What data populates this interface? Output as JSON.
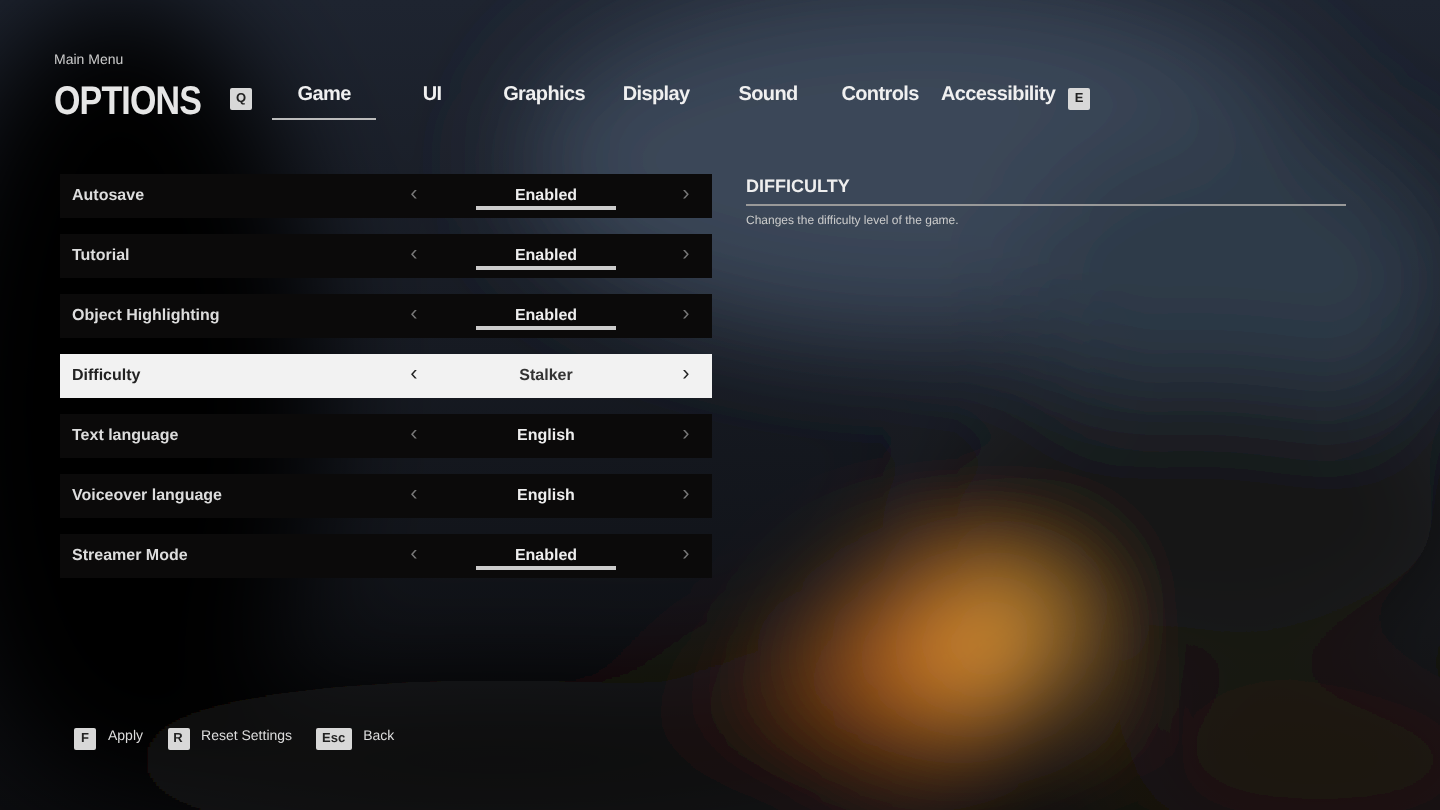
{
  "header": {
    "breadcrumb": "Main Menu",
    "title": "OPTIONS"
  },
  "tabs": {
    "prev_key": "Q",
    "next_key": "E",
    "items": [
      {
        "label": "Game",
        "selected": true
      },
      {
        "label": "UI",
        "selected": false
      },
      {
        "label": "Graphics",
        "selected": false
      },
      {
        "label": "Display",
        "selected": false
      },
      {
        "label": "Sound",
        "selected": false
      },
      {
        "label": "Controls",
        "selected": false
      },
      {
        "label": "Accessibility",
        "selected": false
      }
    ]
  },
  "settings": [
    {
      "label": "Autosave",
      "value": "Enabled",
      "kind": "toggle",
      "selected": false,
      "prev": "‹",
      "next": "›"
    },
    {
      "label": "Tutorial",
      "value": "Enabled",
      "kind": "toggle",
      "selected": false,
      "prev": "‹",
      "next": "›"
    },
    {
      "label": "Object Highlighting",
      "value": "Enabled",
      "kind": "toggle",
      "selected": false,
      "prev": "‹",
      "next": "›"
    },
    {
      "label": "Difficulty",
      "value": "Stalker",
      "kind": "choice",
      "selected": true,
      "prev": "‹",
      "next": "›"
    },
    {
      "label": "Text language",
      "value": "English",
      "kind": "choice",
      "selected": false,
      "prev": "‹",
      "next": "›"
    },
    {
      "label": "Voiceover language",
      "value": "English",
      "kind": "choice",
      "selected": false,
      "prev": "‹",
      "next": "›"
    },
    {
      "label": "Streamer Mode",
      "value": "Enabled",
      "kind": "toggle",
      "selected": false,
      "prev": "‹",
      "next": "›"
    }
  ],
  "info": {
    "title": "DIFFICULTY",
    "description": "Changes the difficulty level of the game."
  },
  "footer": [
    {
      "key": "F",
      "label": "Apply"
    },
    {
      "key": "R",
      "label": "Reset Settings"
    },
    {
      "key": "Esc",
      "label": "Back"
    }
  ]
}
